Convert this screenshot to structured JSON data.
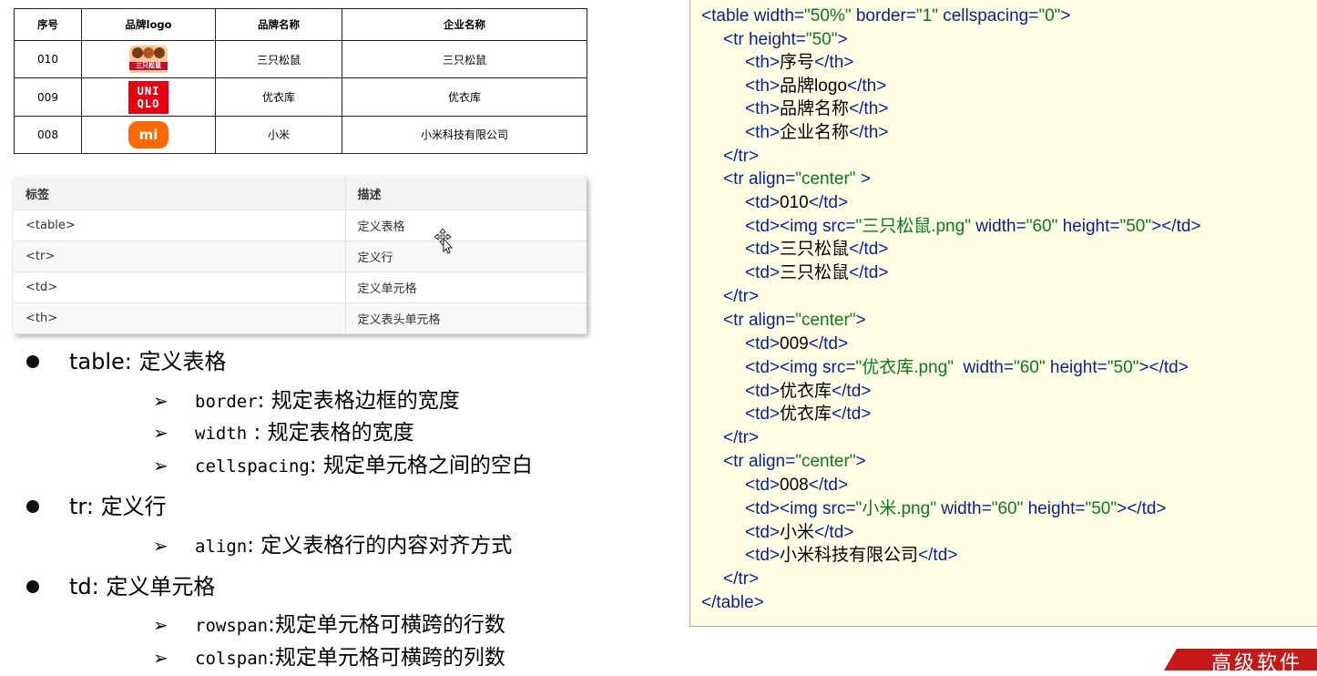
{
  "brand_table": {
    "headers": [
      "序号",
      "品牌logo",
      "品牌名称",
      "企业名称"
    ],
    "rows": [
      {
        "id": "010",
        "logo": "三只松鼠",
        "logo_icon": "three-squirrels-logo-icon",
        "name": "三只松鼠",
        "company": "三只松鼠"
      },
      {
        "id": "009",
        "logo": "UNI QLO",
        "logo_icon": "uniqlo-logo-icon",
        "name": "优衣库",
        "company": "优衣库"
      },
      {
        "id": "008",
        "logo": "mi",
        "logo_icon": "xiaomi-logo-icon",
        "name": "小米",
        "company": "小米科技有限公司"
      }
    ]
  },
  "tag_table": {
    "headers": [
      "标签",
      "描述"
    ],
    "rows": [
      {
        "tag": "<table>",
        "desc": "定义表格"
      },
      {
        "tag": "<tr>",
        "desc": "定义行"
      },
      {
        "tag": "<td>",
        "desc": "定义单元格"
      },
      {
        "tag": "<th>",
        "desc": "定义表头单元格"
      }
    ]
  },
  "notes": {
    "table": {
      "term": "table",
      "sep": ":",
      "desc": "定义表格"
    },
    "table_attrs": [
      {
        "attr": "border",
        "sep": ":",
        "desc": "规定表格边框的宽度"
      },
      {
        "attr": "width",
        "sep": " :",
        "desc": "规定表格的宽度"
      },
      {
        "attr": "cellspacing",
        "sep": ":",
        "desc": "规定单元格之间的空白"
      }
    ],
    "tr": {
      "term": "tr",
      "sep": ":",
      "desc": "定义行"
    },
    "tr_attrs": [
      {
        "attr": "align",
        "sep": ":",
        "desc": "定义表格行的内容对齐方式"
      }
    ],
    "td": {
      "term": "td",
      "sep": ":",
      "desc": "定义单元格"
    },
    "td_attrs": [
      {
        "attr": "rowspan",
        "sep": ":",
        "desc": "规定单元格可横跨的行数"
      },
      {
        "attr": "colspan",
        "sep": ":",
        "desc": "规定单元格可横跨的列数"
      }
    ],
    "arrow_glyph": "➢"
  },
  "code": {
    "l01": {
      "a": "<table ",
      "b": "width",
      "c": "=",
      "d": "\"50%\"",
      "e": " border",
      "f": "=",
      "g": "\"1\"",
      "h": " cellspacing",
      "i": "=",
      "j": "\"0\"",
      "k": ">"
    },
    "l02": {
      "a": "<tr ",
      "b": "height",
      "c": "=",
      "d": "\"50\"",
      "e": ">"
    },
    "l03": {
      "a": "<th>",
      "b": "序号",
      "c": "</th>"
    },
    "l04": {
      "a": "<th>",
      "b": "品牌logo",
      "c": "</th>"
    },
    "l05": {
      "a": "<th>",
      "b": "品牌名称",
      "c": "</th>"
    },
    "l06": {
      "a": "<th>",
      "b": "企业名称",
      "c": "</th>"
    },
    "l07": {
      "a": "</tr>"
    },
    "l08": {
      "a": "<tr ",
      "b": "align",
      "c": "=",
      "d": "\"center\"",
      "e": " >"
    },
    "l09": {
      "a": "<td>",
      "b": "010",
      "c": "</td>"
    },
    "l10": {
      "a": "<td><img ",
      "b": "src",
      "c": "=",
      "d": "\"三只松鼠.png\"",
      "e": " width",
      "f": "=",
      "g": "\"60\"",
      "h": " height",
      "i": "=",
      "j": "\"50\"",
      "k": "></td>"
    },
    "l11": {
      "a": "<td>",
      "b": "三只松鼠",
      "c": "</td>"
    },
    "l12": {
      "a": "<td>",
      "b": "三只松鼠",
      "c": "</td>"
    },
    "l13": {
      "a": "</tr>"
    },
    "l14": {
      "a": "<tr ",
      "b": "align",
      "c": "=",
      "d": "\"center\"",
      "e": ">"
    },
    "l15": {
      "a": "<td>",
      "b": "009",
      "c": "</td>"
    },
    "l16": {
      "a": "<td><img ",
      "b": "src",
      "c": "=",
      "d": "\"优衣库.png\"",
      "e": "  width",
      "f": "=",
      "g": "\"60\"",
      "h": " height",
      "i": "=",
      "j": "\"50\"",
      "k": "></td>"
    },
    "l17": {
      "a": "<td>",
      "b": "优衣库",
      "c": "</td>"
    },
    "l18": {
      "a": "<td>",
      "b": "优衣库",
      "c": "</td>"
    },
    "l19": {
      "a": "</tr>"
    },
    "l20": {
      "a": "<tr ",
      "b": "align",
      "c": "=",
      "d": "\"center\"",
      "e": ">"
    },
    "l21": {
      "a": "<td>",
      "b": "008",
      "c": "</td>"
    },
    "l22": {
      "a": "<td><img ",
      "b": "src",
      "c": "=",
      "d": "\"小米.png\"",
      "e": " width",
      "f": "=",
      "g": "\"60\"",
      "h": " height",
      "i": "=",
      "j": "\"50\"",
      "k": "></td>"
    },
    "l23": {
      "a": "<td>",
      "b": "小米",
      "c": "</td>"
    },
    "l24": {
      "a": "<td>",
      "b": "小米科技有限公司",
      "c": "</td>"
    },
    "l25": {
      "a": "</tr>"
    },
    "l26": {
      "a": "</table>"
    }
  },
  "corner_logo": {
    "text": "高级软件"
  },
  "colors": {
    "code_bg": "#ffffe6",
    "tag_color": "#0a1f8f",
    "value_color": "#0b7a1c",
    "logo_red": "#c61a1a"
  }
}
